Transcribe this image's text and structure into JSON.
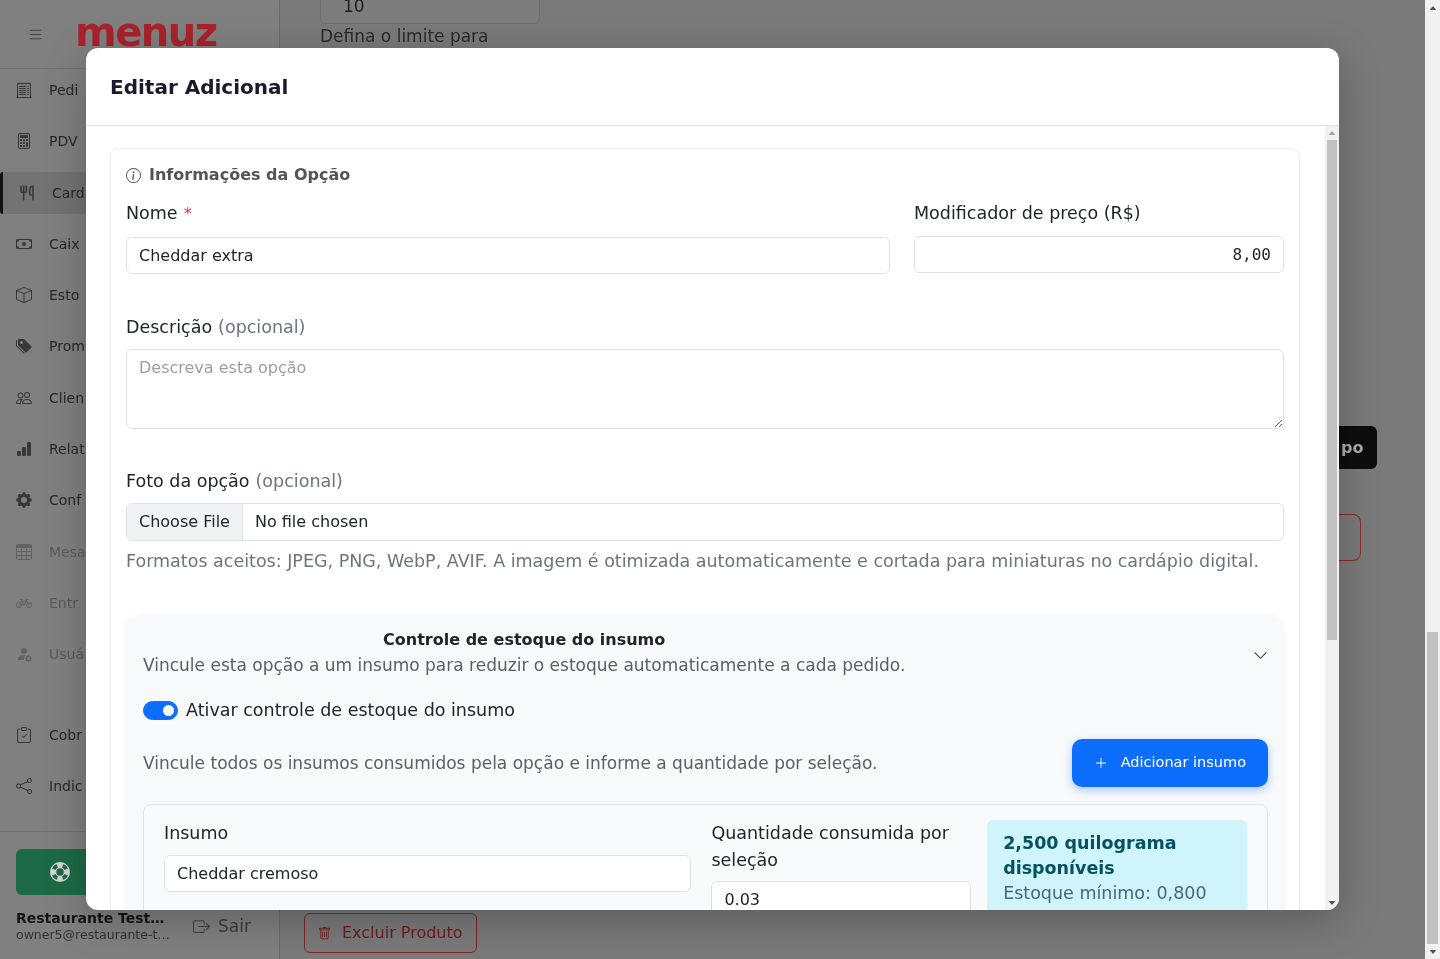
{
  "sidebar": {
    "logo": "menuz",
    "items": [
      {
        "label": "Pedi",
        "selected": false,
        "disabled": false
      },
      {
        "label": "PDV",
        "selected": false,
        "disabled": false
      },
      {
        "label": "Card",
        "selected": true,
        "disabled": false
      },
      {
        "label": "Caix",
        "selected": false,
        "disabled": false
      },
      {
        "label": "Esto",
        "selected": false,
        "disabled": false
      },
      {
        "label": "Prom",
        "selected": false,
        "disabled": false
      },
      {
        "label": "Clien",
        "selected": false,
        "disabled": false
      },
      {
        "label": "Relat",
        "selected": false,
        "disabled": false
      },
      {
        "label": "Conf",
        "selected": false,
        "disabled": false
      },
      {
        "label": "Mesa",
        "selected": false,
        "disabled": true
      },
      {
        "label": "Entr",
        "selected": false,
        "disabled": true
      },
      {
        "label": "Usuá",
        "selected": false,
        "disabled": true
      }
    ],
    "lower_items": [
      {
        "label": "Cobr",
        "selected": false,
        "disabled": false
      },
      {
        "label": "Indic",
        "selected": false,
        "disabled": false
      }
    ],
    "account": {
      "name": "Restaurante Test…",
      "email": "owner5@restaurante-t…"
    },
    "logout": "Sair"
  },
  "page": {
    "limit_field": {
      "value": "10"
    },
    "limit_hint": "Defina o limite para",
    "group_button": "po",
    "delete_button": "Excluir Produto"
  },
  "modal": {
    "title": "Editar Adicional",
    "section_title": "Informações da Opção",
    "name_field": {
      "label": "Nome",
      "required_mark": "*",
      "value": "Cheddar extra"
    },
    "price_field": {
      "label": "Modificador de preço (R$)",
      "value": "8,00"
    },
    "description_field": {
      "label": "Descrição",
      "optional": "(opcional)",
      "placeholder": "Descreva esta opção"
    },
    "photo_field": {
      "label": "Foto da opção",
      "optional": "(opcional)",
      "button": "Choose File",
      "status": "No file chosen",
      "help": "Formatos aceitos: JPEG, PNG, WebP, AVIF. A imagem é otimizada automaticamente e cortada para miniaturas no cardápio digital."
    },
    "stock_control": {
      "title": "Controle de estoque do insumo",
      "description": "Vincule esta opção a um insumo para reduzir o estoque automaticamente a cada pedido.",
      "toggle": {
        "label": "Ativar controle de estoque do insumo",
        "on": true
      },
      "hint": "Vincule todos os insumos consumidos pela opção e informe a quantidade por seleção.",
      "add_button": "Adicionar insumo",
      "items": [
        {
          "ingredient_label": "Insumo",
          "ingredient_value": "Cheddar cremoso",
          "quantity_label": "Quantidade consumida por seleção",
          "quantity_value": "0.03",
          "stock_title": "2,500 quilograma disponíveis",
          "stock_minimum": "Estoque mínimo: 0,800"
        }
      ]
    }
  }
}
